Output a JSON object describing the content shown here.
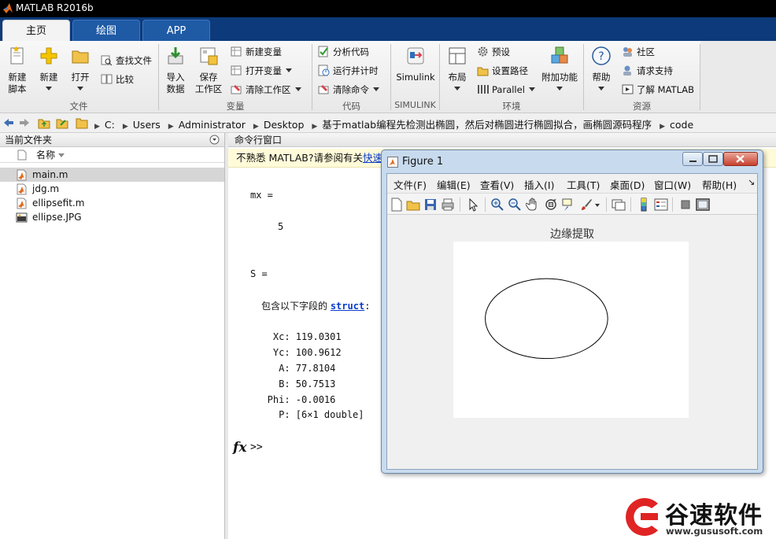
{
  "app": {
    "title": "MATLAB R2016b"
  },
  "tabs": [
    {
      "label": "主页"
    },
    {
      "label": "绘图"
    },
    {
      "label": "APP"
    }
  ],
  "ribbon": {
    "file": {
      "new_script": "新建\n脚本",
      "new": "新建",
      "open": "打开",
      "find_files": "查找文件",
      "compare": "比较",
      "group": "文件"
    },
    "variable": {
      "import": "导入\n数据",
      "save_ws": "保存\n工作区",
      "new_var": "新建变量",
      "open_var": "打开变量",
      "clear_ws": "清除工作区",
      "group": "变量"
    },
    "code": {
      "analyze": "分析代码",
      "run_time": "运行并计时",
      "clear_cmd": "清除命令",
      "group": "代码"
    },
    "simulink": {
      "label": "Simulink",
      "group": "SIMULINK"
    },
    "env": {
      "layout": "布局",
      "prefs": "预设",
      "set_path": "设置路径",
      "parallel": "Parallel",
      "addons": "附加功能",
      "group": "环境"
    },
    "resources": {
      "help": "帮助",
      "community": "社区",
      "support": "请求支持",
      "learn": "了解 MATLAB",
      "group": "资源"
    }
  },
  "address": {
    "crumbs": [
      "C:",
      "Users",
      "Administrator",
      "Desktop",
      "基于matlab编程先检测出椭圆，然后对椭圆进行椭圆拟合，画椭圆源码程序",
      "code"
    ]
  },
  "current_folder": {
    "title": "当前文件夹",
    "column": "名称",
    "files": [
      {
        "name": "main.m",
        "icon": "m-file-icon",
        "selected": true
      },
      {
        "name": "jdg.m",
        "icon": "m-file-icon",
        "selected": false
      },
      {
        "name": "ellipsefit.m",
        "icon": "m-file-icon",
        "selected": false
      },
      {
        "name": "ellipse.JPG",
        "icon": "image-file-icon",
        "selected": false
      }
    ]
  },
  "command_window": {
    "title": "命令行窗口",
    "notice_prefix": "不熟悉 MATLAB?请参阅有关",
    "notice_link": "快速入门",
    "lines": {
      "mx_label": "mx =",
      "mx_value": "5",
      "s_label": "S =",
      "struct_prefix": "包含以下字段的 ",
      "struct_link": "struct",
      "struct_suffix": ":",
      "xc": "    Xc: 119.0301",
      "yc": "    Yc: 100.9612",
      "a": "     A: 77.8104",
      "b": "     B: 50.7513",
      "phi": "   Phi: -0.0016",
      "p": "     P: [6×1 double]"
    },
    "prompt": ">>"
  },
  "figure": {
    "title": "Figure 1",
    "menus": [
      "文件(F)",
      "编辑(E)",
      "查看(V)",
      "插入(I)",
      "工具(T)",
      "桌面(D)",
      "窗口(W)",
      "帮助(H)"
    ],
    "axes_title": "边缘提取",
    "ellipse": {
      "center_x": 119.0301,
      "center_y": 100.9612,
      "a": 77.8104,
      "b": 50.7513,
      "phi": -0.0016
    },
    "axes_size": {
      "width": 299,
      "height": 224
    }
  },
  "watermark": {
    "name": "谷速软件",
    "url": "www.gususoft.com"
  }
}
